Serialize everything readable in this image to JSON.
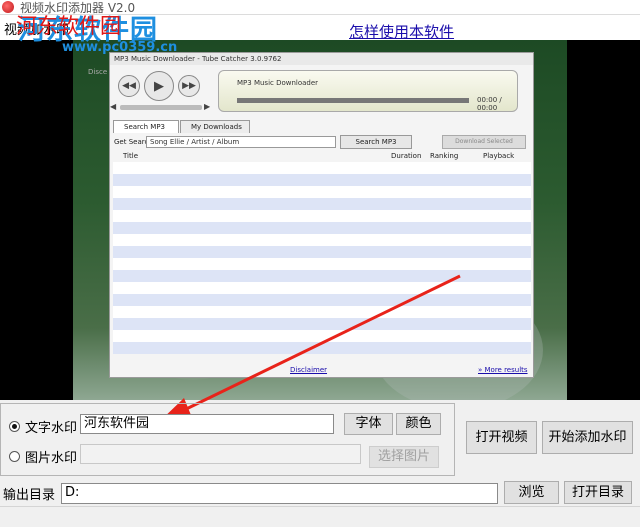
{
  "window": {
    "title": "视频水印添加器 V2.0"
  },
  "menu": {
    "item": "视频加水印",
    "help_link": "怎样使用本软件"
  },
  "watermark_overlay": {
    "logo": "河东软件园",
    "url": "www.pc0359.cn",
    "red_text": "河东软件园"
  },
  "video_preview": {
    "app_title": "MP3 Music Downloader - Tube Catcher 3.0.9762",
    "side_text": "Disce",
    "player": {
      "rewind_icon": "◀◀",
      "play_icon": "▶",
      "forward_icon": "▶▶",
      "vol_left": "◀",
      "vol_right": "▶"
    },
    "now_playing_label": "MP3 Music Downloader",
    "time": "00:00 / 00:00",
    "tabs": [
      "Search MP3",
      "My Downloads"
    ],
    "search_label": "Get Search",
    "search_value": "Song Ellie / Artist / Album",
    "search_button": "Search MP3",
    "download_button": "Download Selected",
    "columns": [
      "Title",
      "Duration",
      "Ranking",
      "Playback"
    ],
    "row_count": 16,
    "footer_left": "Disclaimer",
    "footer_right": "» More results"
  },
  "watermark": {
    "text_label": "文字水印",
    "text_value": "河东软件园",
    "font_button": "字体",
    "color_button": "颜色",
    "image_label": "图片水印",
    "image_value": "",
    "select_image_button": "选择图片"
  },
  "actions": {
    "open_video": "打开视频",
    "start": "开始添加水印"
  },
  "output": {
    "label": "输出目录",
    "value": "D:",
    "browse": "浏览",
    "open_dir": "打开目录"
  },
  "colors": {
    "arrow": "#e8231a",
    "watermark_blue": "#1e8fe0",
    "watermark_red": "#e01818"
  }
}
